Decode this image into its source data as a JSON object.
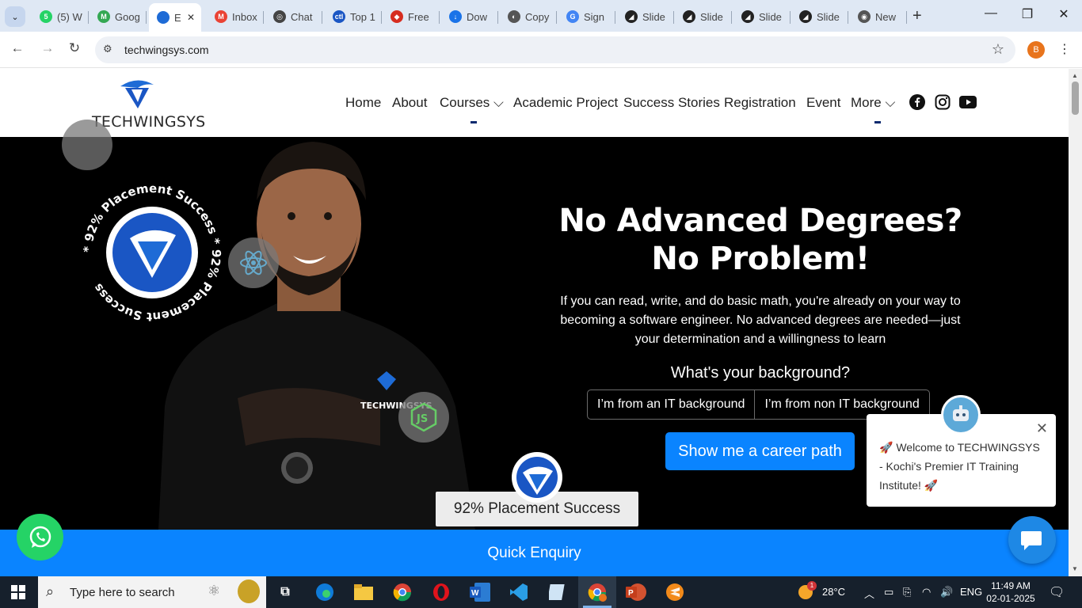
{
  "browser": {
    "tabs": [
      {
        "label": "(5) W",
        "fav_color": "#25d366",
        "fav_text": "5"
      },
      {
        "label": "Goog",
        "fav_color": "#34a853",
        "fav_text": "M"
      },
      {
        "label": "E",
        "fav_color": "#1e6bd6",
        "fav_text": "",
        "active": true
      },
      {
        "label": "Inbox",
        "fav_color": "#ea4335",
        "fav_text": "M"
      },
      {
        "label": "Chat",
        "fav_color": "#444444",
        "fav_text": "◎"
      },
      {
        "label": "Top 1",
        "fav_color": "#1a56c4",
        "fav_text": "ctl"
      },
      {
        "label": "Free",
        "fav_color": "#d62d20",
        "fav_text": "◆"
      },
      {
        "label": "Dow",
        "fav_color": "#1a73e8",
        "fav_text": "↓"
      },
      {
        "label": "Copy",
        "fav_color": "#555555",
        "fav_text": "◐"
      },
      {
        "label": "Sign",
        "fav_color": "#4285f4",
        "fav_text": "G"
      },
      {
        "label": "Slide",
        "fav_color": "#222222",
        "fav_text": "◢"
      },
      {
        "label": "Slide",
        "fav_color": "#222222",
        "fav_text": "◢"
      },
      {
        "label": "Slide",
        "fav_color": "#222222",
        "fav_text": "◢"
      },
      {
        "label": "Slide",
        "fav_color": "#222222",
        "fav_text": "◢"
      },
      {
        "label": "New",
        "fav_color": "#555555",
        "fav_text": "◉"
      }
    ],
    "url": "techwingsys.com",
    "profile_initial": "B"
  },
  "site": {
    "logo_text": "TECHWINGSYS",
    "nav": [
      "Home",
      "About",
      "Courses",
      "Academic Project",
      "Success Stories",
      "Registration",
      "Event",
      "More"
    ],
    "hero": {
      "title_line1": "No Advanced Degrees?",
      "title_line2": "No Problem!",
      "description": "If you can read, write, and do basic math, you're already on your way to becoming a software engineer. No advanced degrees are needed—just your determination and a willingness to learn",
      "question": "What's your background?",
      "option_it": "I’m from an IT background",
      "option_non_it": "I’m from non IT background",
      "cta": "Show me a career path",
      "badge_ring_text": "* 92% Placement Success * 92% Placement Success",
      "placement_label": "92% Placement Success",
      "shirt_text": "TECHWINGSYS"
    },
    "enquiry_label": "Quick Enquiry",
    "chat_message": "🚀 Welcome to TECHWINGSYS - Kochi's Premier IT Training Institute! 🚀",
    "colors": {
      "primary": "#0a84ff",
      "whatsapp": "#25d366",
      "hero_bg": "#000000"
    }
  },
  "taskbar": {
    "search_placeholder": "Type here to search",
    "weather": "28°C",
    "language": "ENG",
    "time": "11:49 AM",
    "date": "02-01-2025",
    "weather_badge": "1"
  }
}
